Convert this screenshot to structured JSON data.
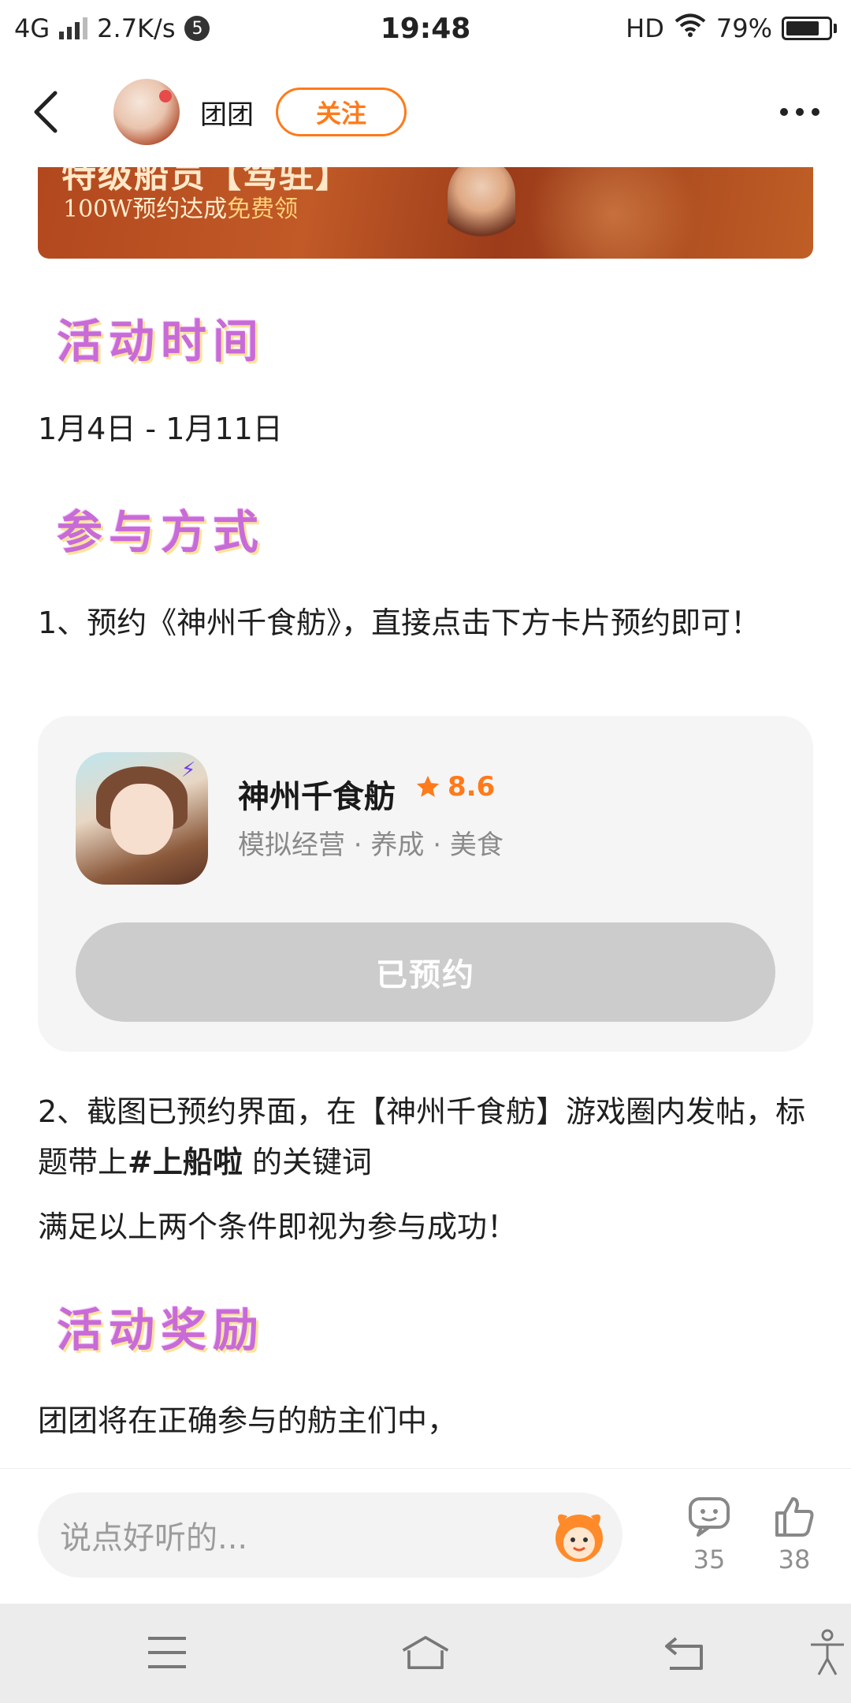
{
  "status_bar": {
    "network": "4G",
    "speed": "2.7K/s",
    "notification_count": "5",
    "time": "19:48",
    "hd": "HD",
    "battery": "79%",
    "battery_level": 0.79
  },
  "nav": {
    "username": "团团",
    "follow_label": "关注"
  },
  "banner": {
    "headline_partial": "特级船员【驾驻】",
    "sub_prefix": "100W预约达成",
    "sub_highlight": "免费领"
  },
  "sections": {
    "time_title": "活动时间",
    "time_value": "1月4日 - 1月11日",
    "join_title": "参与方式",
    "step1": "1、预约《神州千食舫》，直接点击下方卡片预约即可！",
    "step2_prefix": "2、截图已预约界面，在【神州千食舫】游戏圈内发帖，标题带上",
    "step2_keyword": "#上船啦",
    "step2_suffix": " 的关键词",
    "condition": "满足以上两个条件即视为参与成功！",
    "reward_title": "活动奖励",
    "reward_text": "团团将在正确参与的舫主们中，"
  },
  "game_card": {
    "name": "神州千食舫",
    "rating": "8.6",
    "tags": "模拟经营 · 养成 · 美食",
    "button_label": "已预约"
  },
  "comment_bar": {
    "placeholder": "说点好听的...",
    "comment_count": "35",
    "like_count": "38"
  },
  "colors": {
    "accent": "#ff7a1a",
    "section_title": "#c86bd8",
    "reserved_button": "#cccccc"
  },
  "icons": [
    "back-icon",
    "more-icon",
    "star-icon",
    "emoji-icon",
    "comment-icon",
    "like-icon",
    "menu-icon",
    "home-icon",
    "return-icon",
    "accessibility-icon"
  ]
}
